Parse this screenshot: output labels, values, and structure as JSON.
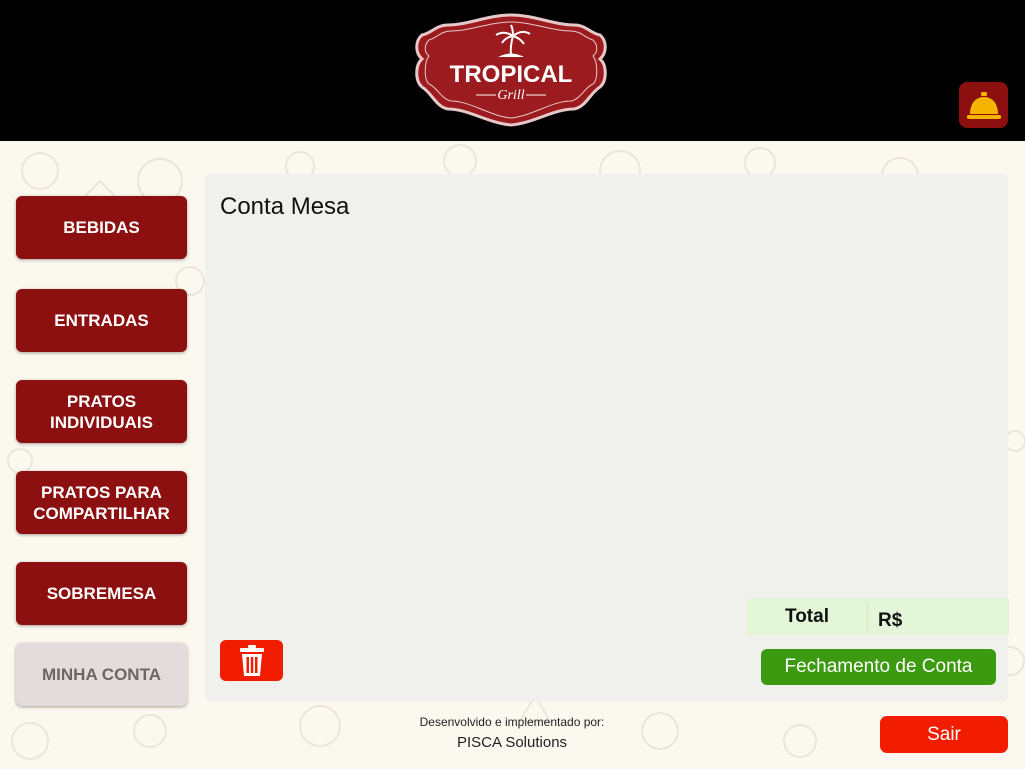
{
  "header": {
    "logo": {
      "brand": "TROPICAL",
      "sub": "Grill"
    },
    "call_waiter_icon": "service-bell-icon"
  },
  "sidebar": {
    "items": [
      {
        "label": "BEBIDAS",
        "active": false
      },
      {
        "label": "ENTRADAS",
        "active": false
      },
      {
        "label": "PRATOS INDIVIDUAIS",
        "active": false
      },
      {
        "label": "PRATOS PARA COMPARTILHAR",
        "active": false
      },
      {
        "label": "SOBREMESA",
        "active": false
      },
      {
        "label": "MINHA CONTA",
        "active": true
      }
    ]
  },
  "main": {
    "title": "Conta Mesa",
    "total_label": "Total",
    "total_currency": "R$",
    "delete_icon": "trash-icon",
    "close_account_label": "Fechamento de Conta"
  },
  "footer": {
    "developed_by": "Desenvolvido e implementado por:",
    "company": "PISCA Solutions",
    "exit_label": "Sair"
  },
  "colors": {
    "header_bg": "#000000",
    "brand_red": "#8c1010",
    "danger_red": "#f21c00",
    "success_green": "#3c9a10",
    "total_bg": "#e3f7d8",
    "panel_bg": "#f0f0ec",
    "page_bg": "#fbf8ef",
    "bell_yellow": "#f4b400"
  }
}
